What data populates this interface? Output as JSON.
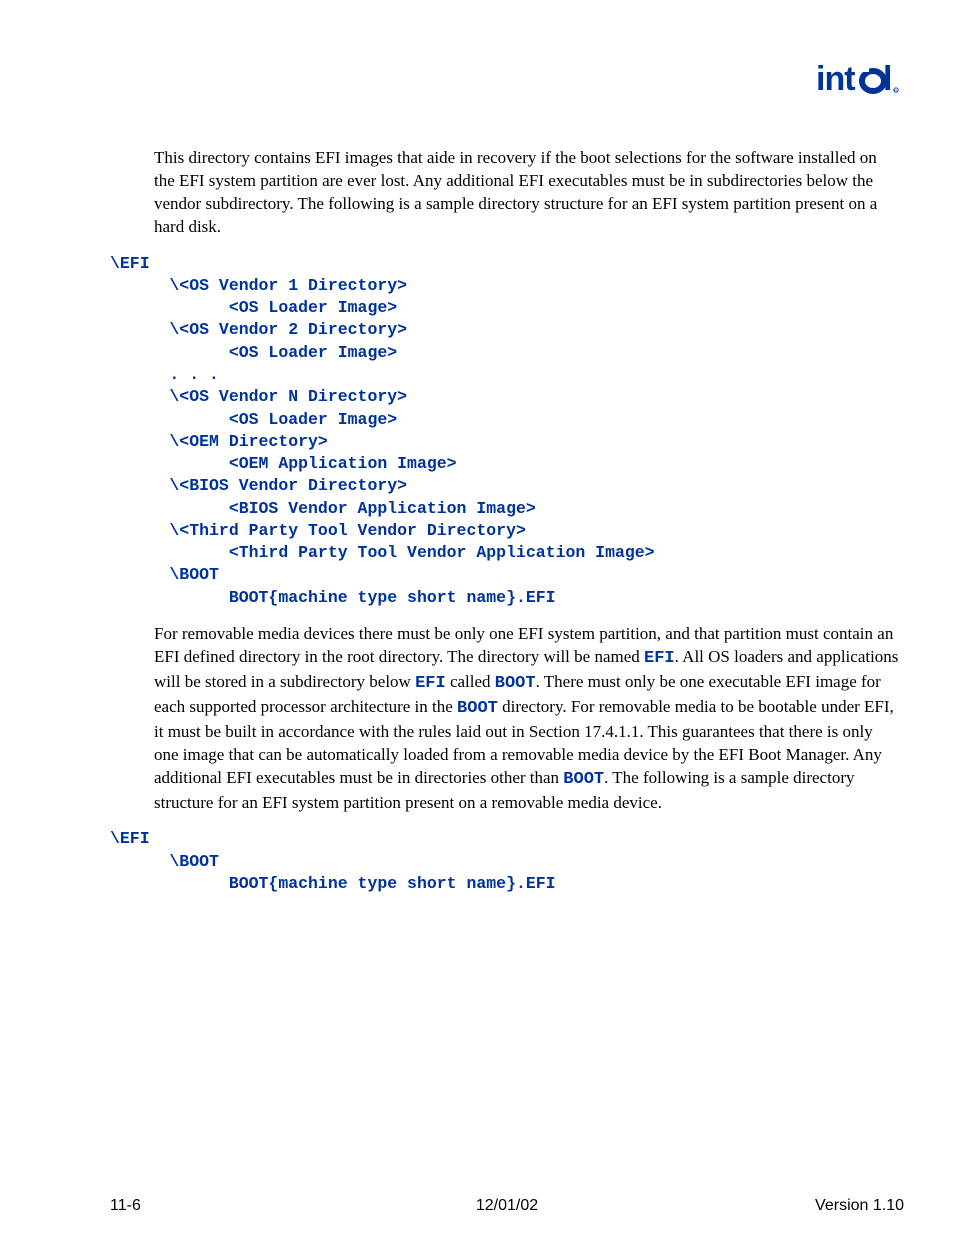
{
  "logo_text": "intel",
  "para1_a": "This directory contains EFI images that aide in recovery if the boot selections for the software installed on the EFI system partition are ever lost.  Any additional EFI executables must be in subdirectories below the vendor subdirectory.  The following is a sample directory structure for an EFI system partition present on a hard disk.",
  "code1": "\\EFI\n      \\<OS Vendor 1 Directory>\n            <OS Loader Image>\n      \\<OS Vendor 2 Directory>\n            <OS Loader Image>\n      . . .\n      \\<OS Vendor N Directory>\n            <OS Loader Image>\n      \\<OEM Directory>\n            <OEM Application Image>\n      \\<BIOS Vendor Directory>\n            <BIOS Vendor Application Image>\n      \\<Third Party Tool Vendor Directory>\n            <Third Party Tool Vendor Application Image>\n      \\BOOT\n            BOOT{machine type short name}.EFI",
  "para2_a": "For removable media devices there must be only one EFI system partition, and that partition must contain an EFI defined directory in the root directory.  The directory will be named ",
  "para2_b": ".  All OS loaders and applications will be stored in a subdirectory below ",
  "para2_c": " called ",
  "para2_d": ".  There must only be one executable EFI image for each supported processor architecture in the ",
  "para2_e": " directory.  For removable media to be bootable under EFI, it must be built in accordance with the rules laid out in Section 17.4.1.1.  This guarantees that there is only one image that can be automatically loaded from a removable media device by the EFI Boot Manager.  Any additional EFI executables must be in directories other than ",
  "para2_f": ".  The following is a sample directory structure for an EFI system partition present on a removable media device.",
  "kw_efi": "EFI",
  "kw_boot": "BOOT",
  "code2": "\\EFI\n      \\BOOT\n            BOOT{machine type short name}.EFI",
  "footer": {
    "left": "11-6",
    "center": "12/01/02",
    "right": "Version 1.10"
  }
}
